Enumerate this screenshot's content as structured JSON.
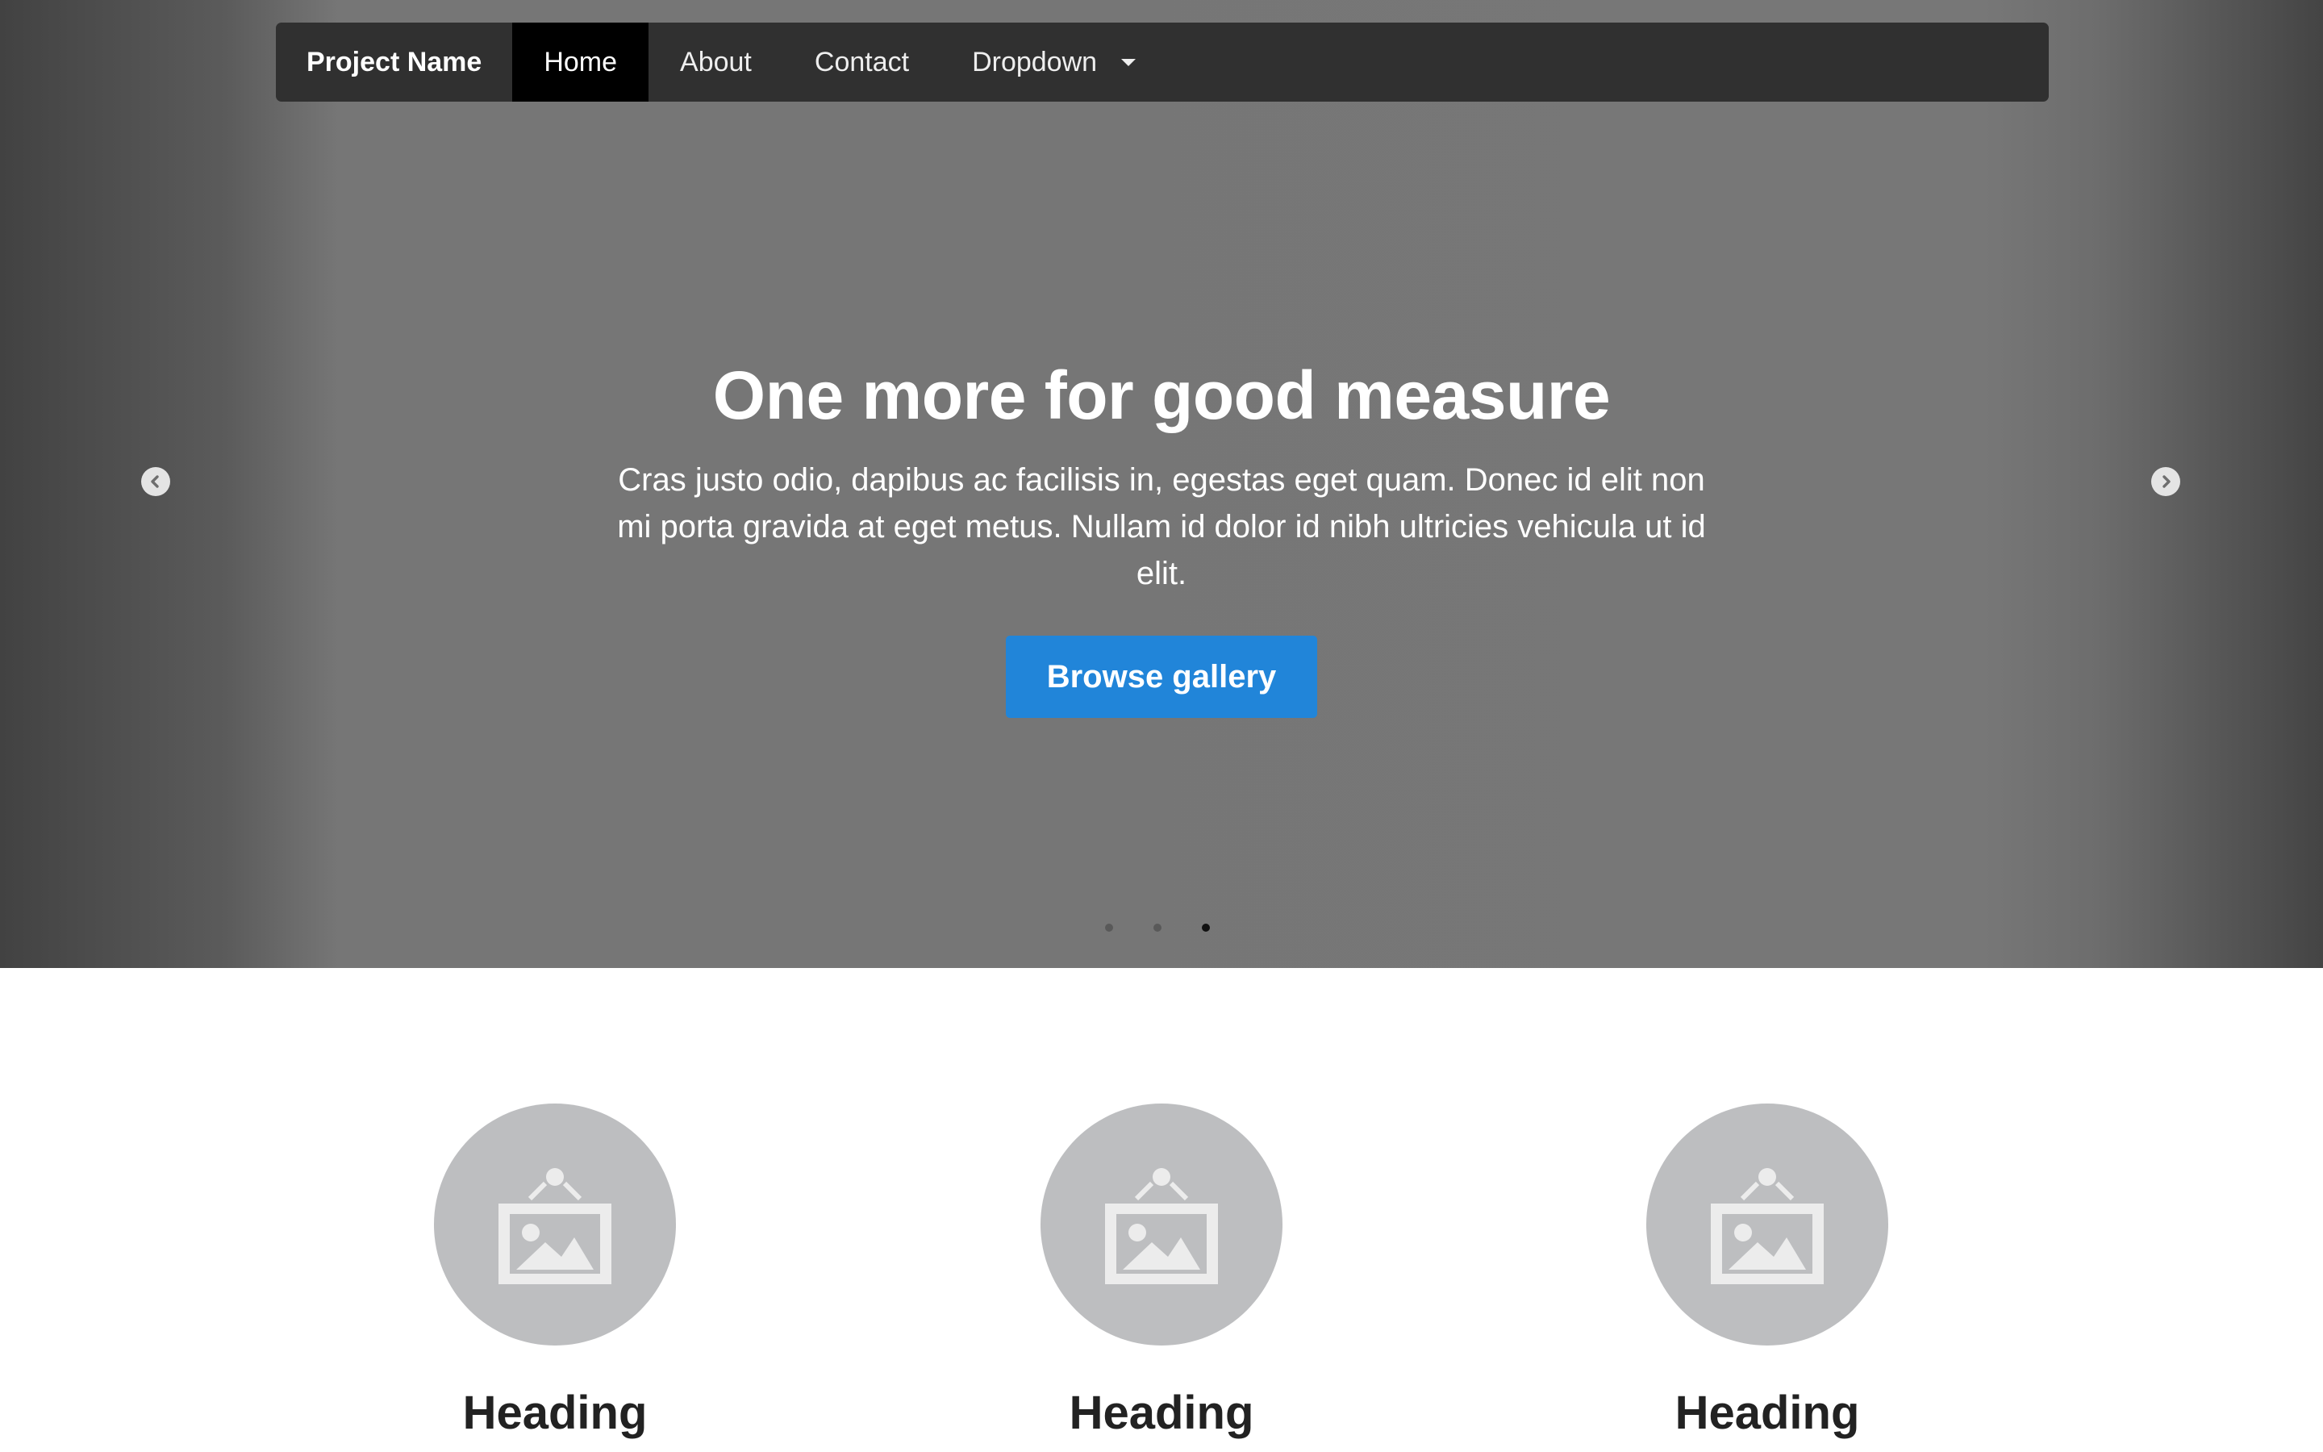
{
  "navbar": {
    "brand": "Project Name",
    "items": [
      {
        "label": "Home",
        "active": true
      },
      {
        "label": "About",
        "active": false
      },
      {
        "label": "Contact",
        "active": false
      },
      {
        "label": "Dropdown",
        "active": false,
        "has_caret": true
      }
    ]
  },
  "carousel": {
    "title": "One more for good measure",
    "text": "Cras justo odio, dapibus ac facilisis in, egestas eget quam. Donec id elit non mi porta gravida at eget metus. Nullam id dolor id nibh ultricies vehicula ut id elit.",
    "button_label": "Browse gallery",
    "slide_count": 3,
    "active_slide": 3,
    "prev_icon": "chevron-left-icon",
    "next_icon": "chevron-right-icon"
  },
  "features": [
    {
      "heading": "Heading",
      "icon": "image-placeholder-icon"
    },
    {
      "heading": "Heading",
      "icon": "image-placeholder-icon"
    },
    {
      "heading": "Heading",
      "icon": "image-placeholder-icon"
    }
  ],
  "colors": {
    "navbar_bg": "#303030",
    "nav_active_bg": "#000000",
    "carousel_bg": "#777777",
    "button_bg": "#2185d9",
    "placeholder_circle": "#bdbec0",
    "placeholder_icon": "#ececec"
  }
}
